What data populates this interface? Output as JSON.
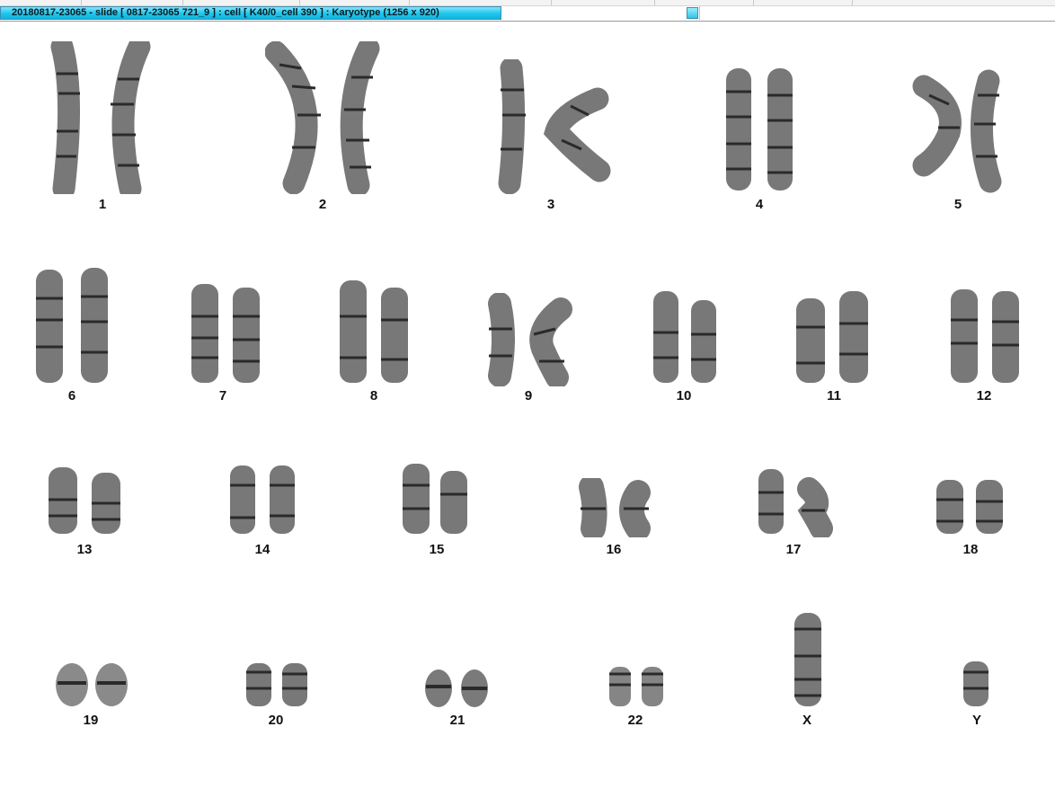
{
  "window": {
    "title": "20180817-23065 - slide [ 0817-23065 721_9 ] : cell [ K40/0_cell 390 ] : Karyotype  (1256 x 920)"
  },
  "karyogram": {
    "chromosomes": [
      {
        "label": "1"
      },
      {
        "label": "2"
      },
      {
        "label": "3"
      },
      {
        "label": "4"
      },
      {
        "label": "5"
      },
      {
        "label": "6"
      },
      {
        "label": "7"
      },
      {
        "label": "8"
      },
      {
        "label": "9"
      },
      {
        "label": "10"
      },
      {
        "label": "11"
      },
      {
        "label": "12"
      },
      {
        "label": "13"
      },
      {
        "label": "14"
      },
      {
        "label": "15"
      },
      {
        "label": "16"
      },
      {
        "label": "17"
      },
      {
        "label": "18"
      },
      {
        "label": "19"
      },
      {
        "label": "20"
      },
      {
        "label": "21"
      },
      {
        "label": "22"
      },
      {
        "label": "X"
      },
      {
        "label": "Y"
      }
    ]
  }
}
